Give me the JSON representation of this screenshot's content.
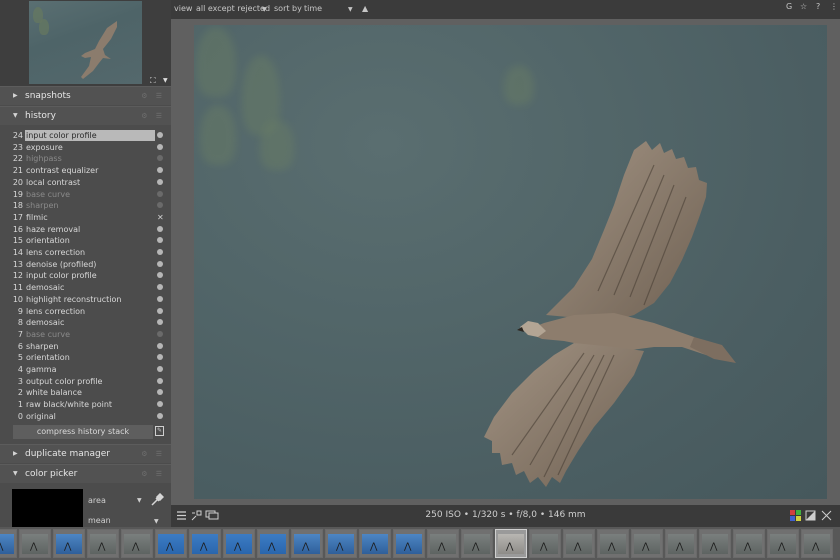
{
  "left_panel": {
    "snapshots_title": "snapshots",
    "history_title": "history",
    "history_items": [
      {
        "num": "24",
        "name": "input color profile",
        "state": "on",
        "selected": true,
        "disabled": false
      },
      {
        "num": "23",
        "name": "exposure",
        "state": "on",
        "selected": false,
        "disabled": false
      },
      {
        "num": "22",
        "name": "highpass",
        "state": "off",
        "selected": false,
        "disabled": true
      },
      {
        "num": "21",
        "name": "contrast equalizer",
        "state": "on",
        "selected": false,
        "disabled": false
      },
      {
        "num": "20",
        "name": "local contrast",
        "state": "on",
        "selected": false,
        "disabled": false
      },
      {
        "num": "19",
        "name": "base curve",
        "state": "off",
        "selected": false,
        "disabled": true
      },
      {
        "num": "18",
        "name": "sharpen",
        "state": "off",
        "selected": false,
        "disabled": true
      },
      {
        "num": "17",
        "name": "filmic",
        "state": "deleted",
        "selected": false,
        "disabled": false
      },
      {
        "num": "16",
        "name": "haze removal",
        "state": "on",
        "selected": false,
        "disabled": false
      },
      {
        "num": "15",
        "name": "orientation",
        "state": "on",
        "selected": false,
        "disabled": false
      },
      {
        "num": "14",
        "name": "lens correction",
        "state": "on",
        "selected": false,
        "disabled": false
      },
      {
        "num": "13",
        "name": "denoise (profiled)",
        "state": "on",
        "selected": false,
        "disabled": false
      },
      {
        "num": "12",
        "name": "input color profile",
        "state": "on",
        "selected": false,
        "disabled": false
      },
      {
        "num": "11",
        "name": "demosaic",
        "state": "on",
        "selected": false,
        "disabled": false
      },
      {
        "num": "10",
        "name": "highlight reconstruction",
        "state": "off",
        "selected": false,
        "disabled": false
      },
      {
        "num": "9",
        "name": "lens correction",
        "state": "on",
        "selected": false,
        "disabled": false
      },
      {
        "num": "8",
        "name": "demosaic",
        "state": "on",
        "selected": false,
        "disabled": false
      },
      {
        "num": "7",
        "name": "base curve",
        "state": "off",
        "selected": false,
        "disabled": true
      },
      {
        "num": "6",
        "name": "sharpen",
        "state": "on",
        "selected": false,
        "disabled": false
      },
      {
        "num": "5",
        "name": "orientation",
        "state": "on",
        "selected": false,
        "disabled": false
      },
      {
        "num": "4",
        "name": "gamma",
        "state": "on",
        "selected": false,
        "disabled": false
      },
      {
        "num": "3",
        "name": "output color profile",
        "state": "on",
        "selected": false,
        "disabled": false
      },
      {
        "num": "2",
        "name": "white balance",
        "state": "on",
        "selected": false,
        "disabled": false
      },
      {
        "num": "1",
        "name": "raw black/white point",
        "state": "on",
        "selected": false,
        "disabled": false
      },
      {
        "num": "0",
        "name": "original",
        "state": "on",
        "selected": false,
        "disabled": false
      }
    ],
    "compress_label": "compress history stack",
    "duplicate_title": "duplicate manager",
    "color_picker_title": "color picker",
    "picker_area_label": "area",
    "picker_mean_label": "mean"
  },
  "topbar": {
    "view_label": "view",
    "filter_value": "all except rejected",
    "sort_label": "sort by",
    "sort_value": "time",
    "sort_order_icon": "▲",
    "right_icons": [
      "G",
      "☆",
      "?",
      "⋮"
    ]
  },
  "infobar": {
    "exif": "250 ISO • 1/320 s • f/8,0 • 146 mm"
  },
  "colors": {
    "panel_bg": "#4c4c4c",
    "header_bg": "#525252",
    "selected_row": "#b9b9b9",
    "center_bg": "#606060",
    "sky_bg": "#4e6266"
  },
  "filmstrip": {
    "thumbnails": [
      {
        "kind": "blue"
      },
      {
        "kind": "grey"
      },
      {
        "kind": "blue"
      },
      {
        "kind": "grey"
      },
      {
        "kind": "grey"
      },
      {
        "kind": "sky"
      },
      {
        "kind": "sky"
      },
      {
        "kind": "sky"
      },
      {
        "kind": "sky"
      },
      {
        "kind": "blue"
      },
      {
        "kind": "blue"
      },
      {
        "kind": "blue"
      },
      {
        "kind": "blue"
      },
      {
        "kind": "grey"
      },
      {
        "kind": "grey"
      },
      {
        "kind": "current"
      },
      {
        "kind": "grey"
      },
      {
        "kind": "grey"
      },
      {
        "kind": "grey"
      },
      {
        "kind": "grey"
      },
      {
        "kind": "grey"
      },
      {
        "kind": "grey"
      },
      {
        "kind": "grey"
      },
      {
        "kind": "grey"
      },
      {
        "kind": "grey"
      }
    ]
  }
}
